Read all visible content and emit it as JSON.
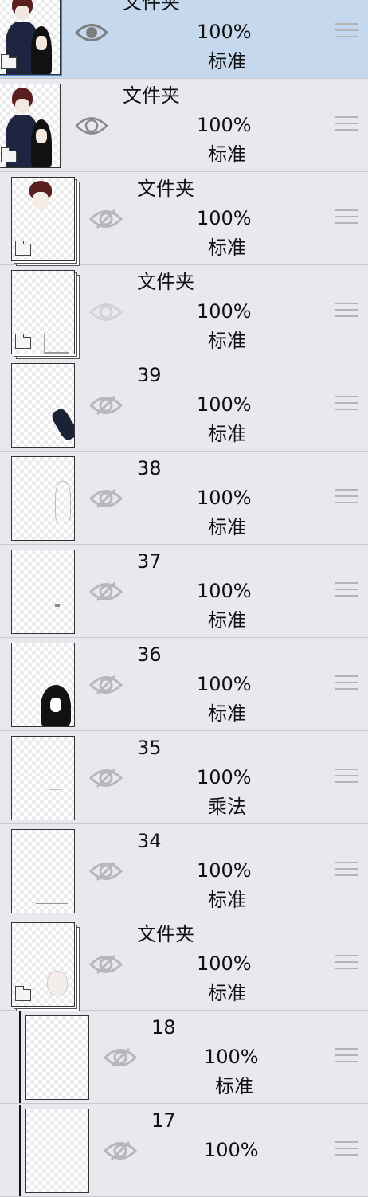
{
  "layers": [
    {
      "name": "文件夹",
      "opacity": "100%",
      "blend": "标准",
      "type": "folder",
      "visible": true,
      "selected": true,
      "indent": 0,
      "thumb": "couple"
    },
    {
      "name": "文件夹",
      "opacity": "100%",
      "blend": "标准",
      "type": "folder",
      "visible": true,
      "selected": false,
      "indent": 0,
      "thumb": "couple"
    },
    {
      "name": "文件夹",
      "opacity": "100%",
      "blend": "标准",
      "type": "folder",
      "visible": false,
      "selected": false,
      "indent": 1,
      "thumb": "boyhead"
    },
    {
      "name": "文件夹",
      "opacity": "100%",
      "blend": "标准",
      "type": "folder",
      "visible": false,
      "selected": false,
      "indent": 1,
      "thumb": "hands",
      "eye_light": true
    },
    {
      "name": "39",
      "opacity": "100%",
      "blend": "标准",
      "type": "layer",
      "visible": false,
      "selected": false,
      "indent": 1,
      "thumb": "sleeve"
    },
    {
      "name": "38",
      "opacity": "100%",
      "blend": "标准",
      "type": "layer",
      "visible": false,
      "selected": false,
      "indent": 1,
      "thumb": "hand"
    },
    {
      "name": "37",
      "opacity": "100%",
      "blend": "标准",
      "type": "layer",
      "visible": false,
      "selected": false,
      "indent": 1,
      "thumb": "dot"
    },
    {
      "name": "36",
      "opacity": "100%",
      "blend": "标准",
      "type": "layer",
      "visible": false,
      "selected": false,
      "indent": 1,
      "thumb": "hair"
    },
    {
      "name": "35",
      "opacity": "100%",
      "blend": "乘法",
      "type": "layer",
      "visible": false,
      "selected": false,
      "indent": 1,
      "thumb": "sketch"
    },
    {
      "name": "34",
      "opacity": "100%",
      "blend": "标准",
      "type": "layer",
      "visible": false,
      "selected": false,
      "indent": 1,
      "thumb": "bottom"
    },
    {
      "name": "文件夹",
      "opacity": "100%",
      "blend": "标准",
      "type": "folder",
      "visible": false,
      "selected": false,
      "indent": 1,
      "thumb": "face"
    },
    {
      "name": "18",
      "opacity": "100%",
      "blend": "标准",
      "type": "layer",
      "visible": false,
      "selected": false,
      "indent": 2,
      "thumb": "empty"
    },
    {
      "name": "17",
      "opacity": "100%",
      "blend": "",
      "type": "layer",
      "visible": false,
      "selected": false,
      "indent": 2,
      "thumb": "empty"
    }
  ]
}
